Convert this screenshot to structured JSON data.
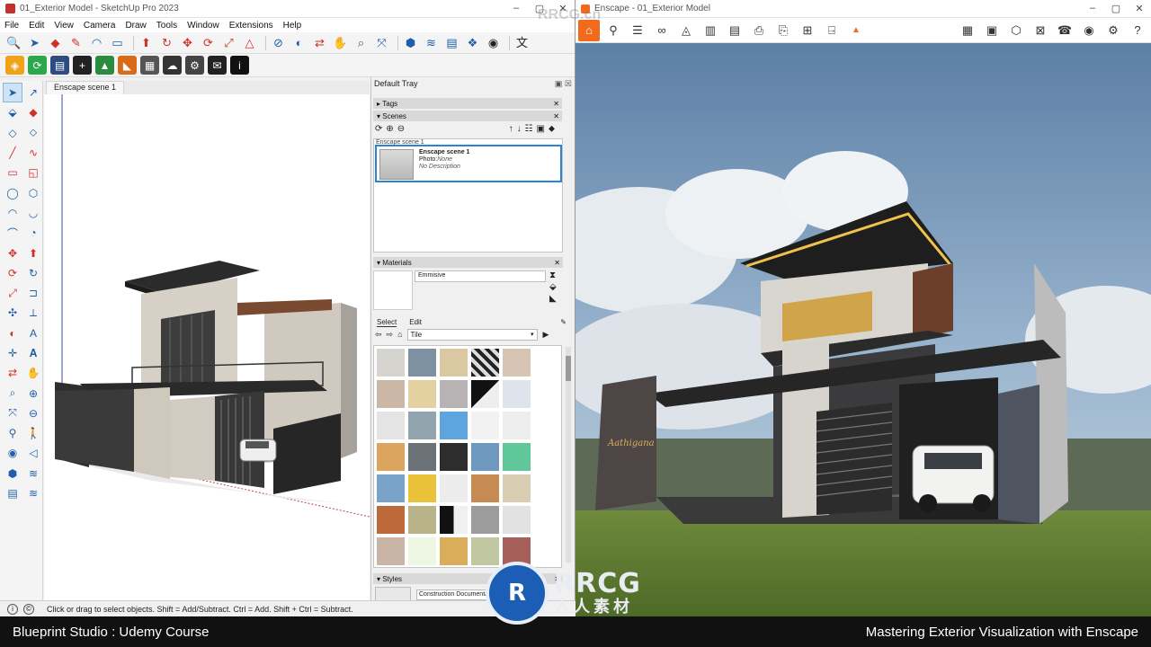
{
  "sketchup": {
    "window_title": "01_Exterior Model - SketchUp Pro 2023",
    "window_controls": [
      "–",
      "▢",
      "✕"
    ],
    "menu": [
      "File",
      "Edit",
      "View",
      "Camera",
      "Draw",
      "Tools",
      "Window",
      "Extensions",
      "Help"
    ],
    "scene_tab": "Enscape scene 1",
    "status_text": "Click or drag to select objects. Shift = Add/Subtract. Ctrl = Add. Shift + Ctrl = Subtract.",
    "tray": {
      "title": "Default Tray",
      "tags_label": "Tags",
      "scenes_label": "Scenes",
      "scene_list_header": "Enscape scene 1",
      "scene": {
        "name": "Enscape scene 1",
        "photo_label": "Photo:",
        "photo_value": "None",
        "description": "No Description"
      },
      "materials_label": "Materials",
      "material_name": "Emmisive",
      "tab_select": "Select",
      "tab_edit": "Edit",
      "collection": "Tile",
      "styles_label": "Styles",
      "style_name": "Construction Documentation"
    }
  },
  "enscape": {
    "window_title": "Enscape - 01_Exterior Model",
    "window_controls": [
      "–",
      "▢",
      "✕"
    ],
    "sign_text": "Aathigana"
  },
  "caption": {
    "left": "Blueprint Studio : Udemy Course",
    "right": "Mastering Exterior Visualization with Enscape"
  },
  "watermark": {
    "logo_letters": "RRCG",
    "logo_subtitle": "人人素材",
    "top_text": "RRCG.cn"
  },
  "colors": {
    "enscape_accent": "#f26b1d",
    "selection_blue": "#2b83d5",
    "caption_bg": "#111111"
  }
}
